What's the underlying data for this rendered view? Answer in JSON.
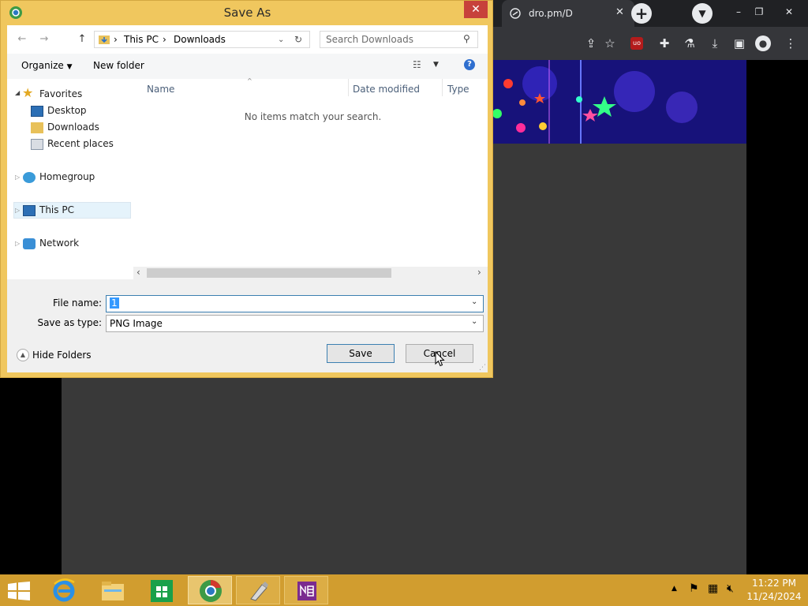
{
  "browser": {
    "tab_title": "dro.pm/D",
    "tab_close": "✕",
    "new_tab": "+",
    "tab_search_icon": "chevron-down-icon",
    "window_controls": [
      "–",
      "❐",
      "✕"
    ],
    "toolbar_icons": [
      "share-icon",
      "star-icon",
      "ublock-icon",
      "extensions-icon",
      "labs-icon",
      "download-icon",
      "sidebar-icon",
      "profile-icon",
      "menu-icon"
    ],
    "ublock_label": "uo"
  },
  "dialog": {
    "title": "Save As",
    "close": "✕",
    "breadcrumb": [
      "This PC",
      "Downloads"
    ],
    "search_placeholder": "Search Downloads",
    "organize": "Organize",
    "new_folder": "New folder",
    "columns": [
      "Name",
      "Date modified",
      "Type"
    ],
    "empty_message": "No items match your search.",
    "nav": {
      "favorites": "Favorites",
      "desktop": "Desktop",
      "downloads": "Downloads",
      "recent": "Recent places",
      "homegroup": "Homegroup",
      "this_pc": "This PC",
      "network": "Network"
    },
    "file_name_label": "File name:",
    "file_name_value": "1",
    "save_type_label": "Save as type:",
    "save_type_value": "PNG Image",
    "hide_folders": "Hide Folders",
    "save": "Save",
    "cancel": "Cancel"
  },
  "taskbar": {
    "apps": [
      "start-icon",
      "internet-explorer-icon",
      "file-explorer-icon",
      "store-icon",
      "chrome-icon",
      "app-icon",
      "onenote-icon"
    ],
    "time": "11:22 PM",
    "date": "11/24/2024"
  },
  "colors": {
    "dialog_frame": "#f0c75e",
    "close_red": "#c7413b",
    "taskbar": "#d19d2f",
    "selection_blue": "#3399ff",
    "browser_dark": "#35363a"
  }
}
